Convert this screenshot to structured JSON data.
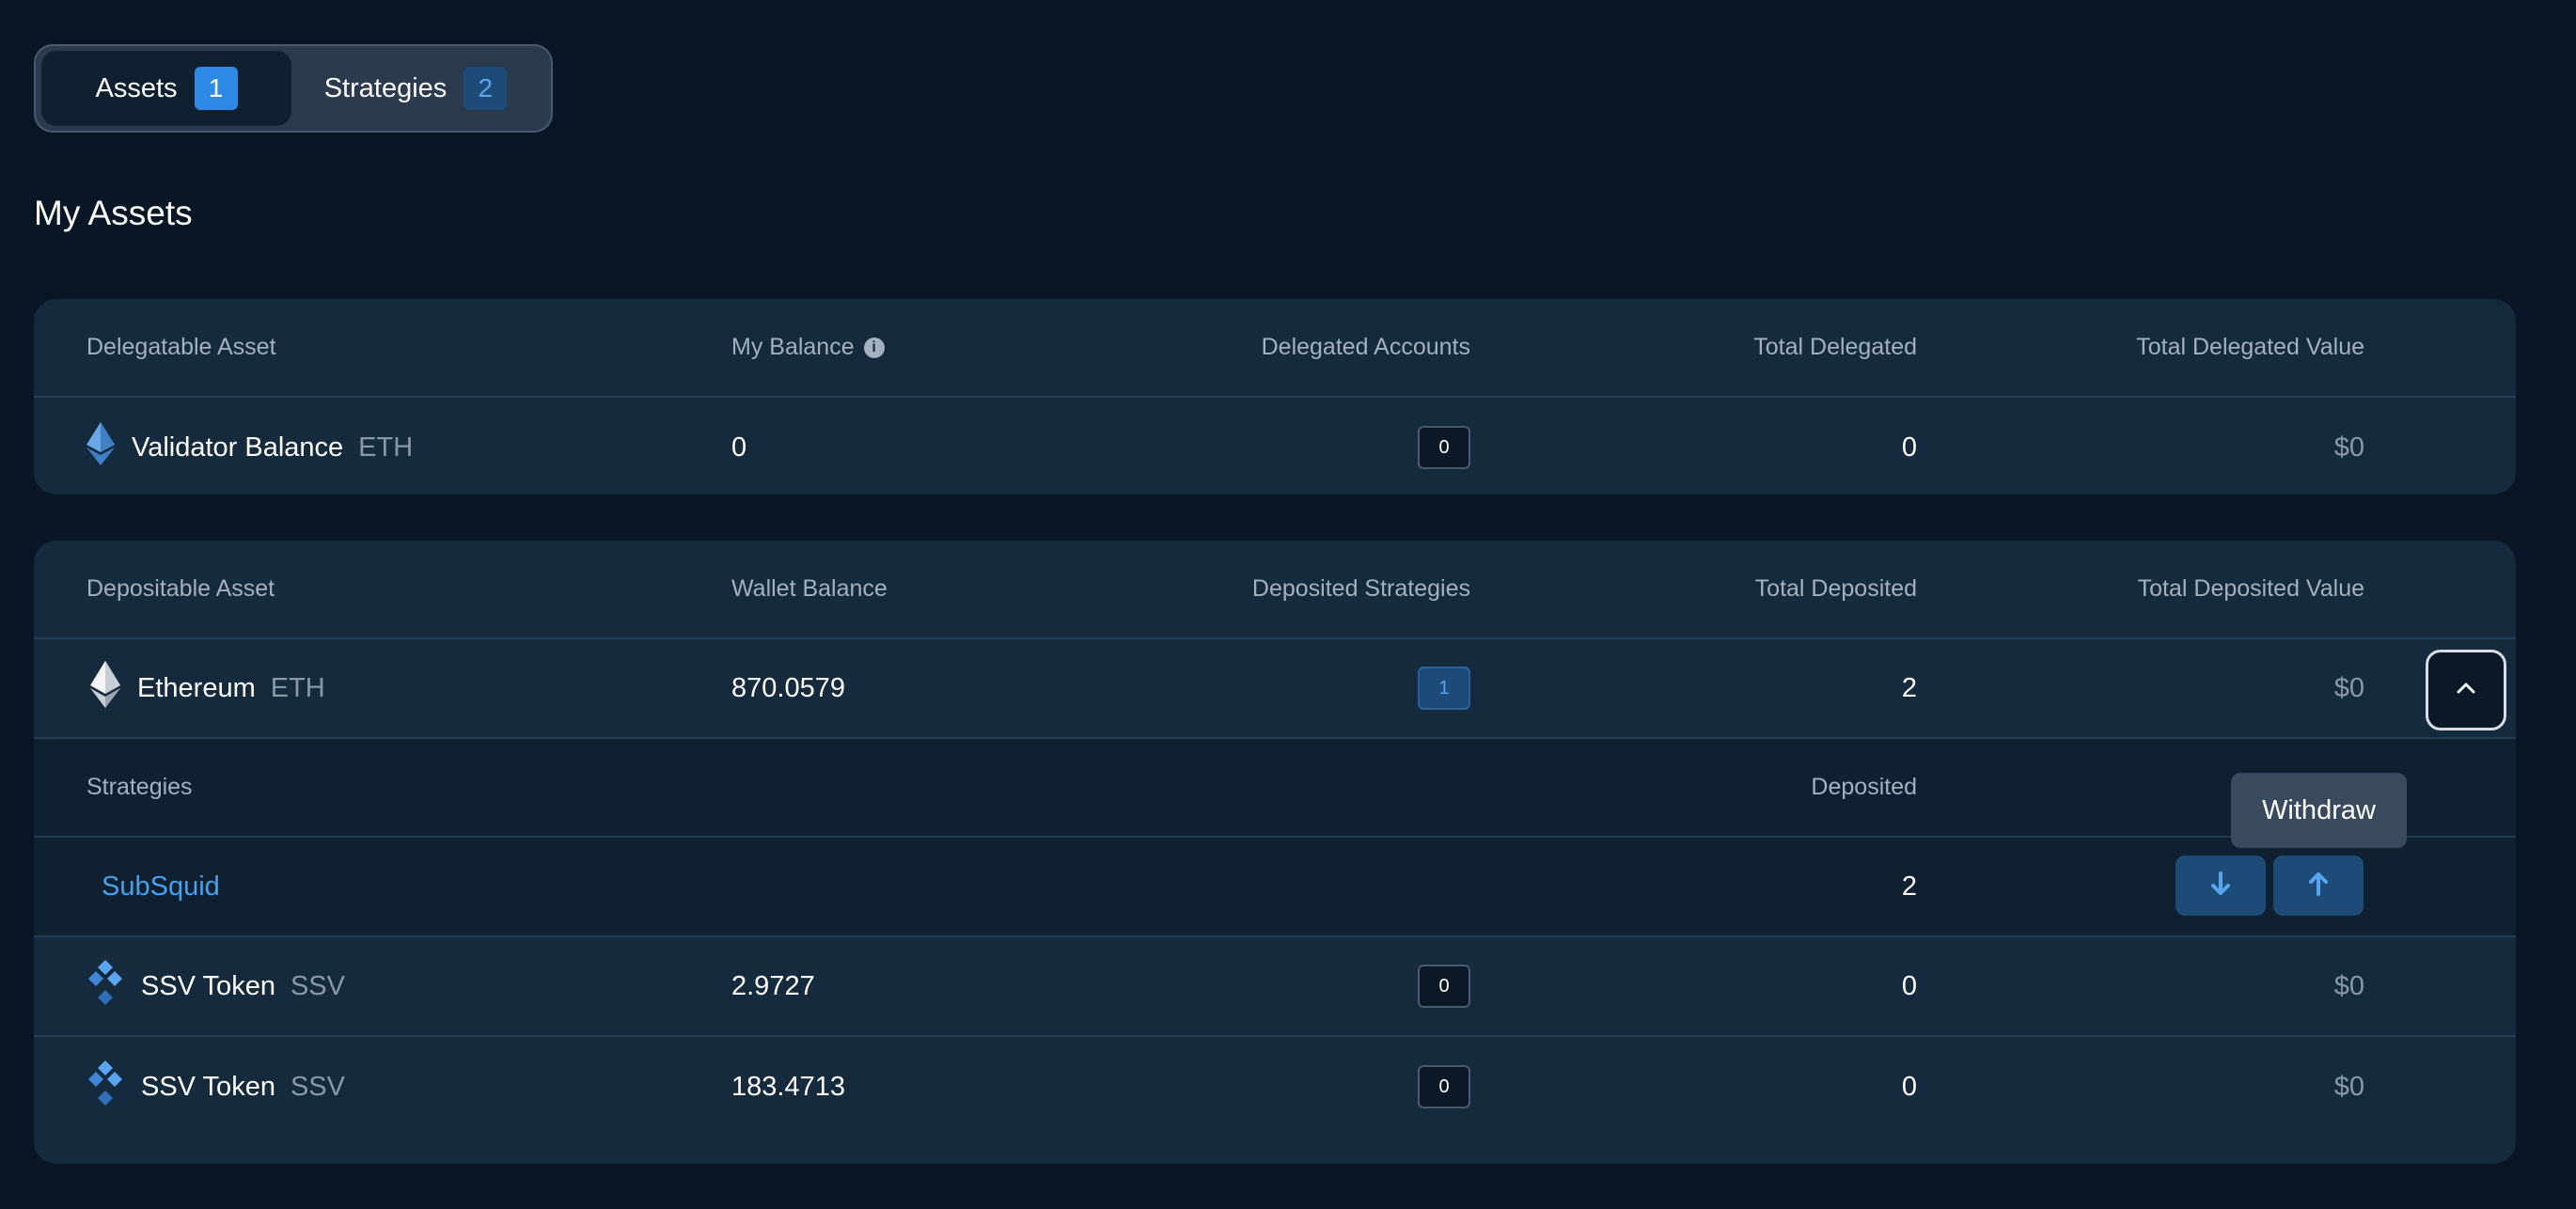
{
  "tabs": [
    {
      "label": "Assets",
      "count": "1",
      "active": true
    },
    {
      "label": "Strategies",
      "count": "2",
      "active": false
    }
  ],
  "page_title": "My Assets",
  "delegatable_table": {
    "headers": [
      "Delegatable Asset",
      "My Balance",
      "Delegated Accounts",
      "Total Delegated",
      "Total Delegated Value"
    ],
    "rows": [
      {
        "icon": "ethereum-icon",
        "name": "Validator Balance",
        "symbol": "ETH",
        "balance": "0",
        "accounts": "0",
        "total": "0",
        "value": "$0"
      }
    ]
  },
  "depositable_table": {
    "headers": [
      "Depositable Asset",
      "Wallet Balance",
      "Deposited Strategies",
      "Total Deposited",
      "Total Deposited Value"
    ],
    "rows": [
      {
        "icon": "ethereum-icon",
        "name": "Ethereum",
        "symbol": "ETH",
        "balance": "870.0579",
        "strategies": "1",
        "total": "2",
        "value": "$0",
        "expanded": true
      },
      {
        "icon": "ssv-token-icon",
        "name": "SSV Token",
        "symbol": "SSV",
        "balance": "2.9727",
        "strategies": "0",
        "total": "0",
        "value": "$0"
      },
      {
        "icon": "ssv-token-icon",
        "name": "SSV Token",
        "symbol": "SSV",
        "balance": "183.4713",
        "strategies": "0",
        "total": "0",
        "value": "$0"
      }
    ],
    "sub_table": {
      "headers": [
        "Strategies",
        "Deposited"
      ],
      "rows": [
        {
          "name": "SubSquid",
          "deposited": "2"
        }
      ]
    }
  },
  "tooltip": "Withdraw",
  "colors": {
    "background": "#081626",
    "card": "#152a3c",
    "accent": "#2f89e6",
    "link": "#4aa0ec"
  }
}
